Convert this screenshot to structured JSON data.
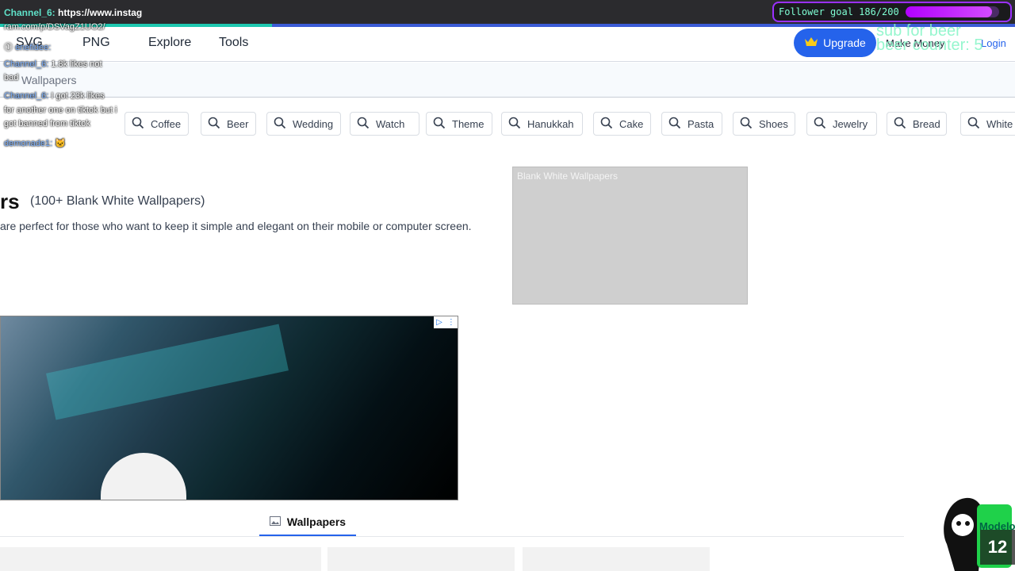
{
  "stream": {
    "chat_header_user": "Channel_6:",
    "chat_header_text": " https://www.instag",
    "follower_goal_label": "Follower goal 186/200",
    "follower_goal_progress": 0.93,
    "bar_progress": 0.268
  },
  "nav": {
    "svg": "SVG",
    "png": "PNG",
    "explore": "Explore",
    "tools": "Tools",
    "upgrade": "Upgrade",
    "make_money": "Make Money",
    "login": "Login"
  },
  "overlay_text": {
    "line1": "sub for beer",
    "line2": "beer counter: 5"
  },
  "search": {
    "placeholder": "Wallpapers"
  },
  "tags": [
    "Coffee",
    "Beer",
    "Wedding",
    "Watch",
    "Theme",
    "Hanukkah",
    "Cake",
    "Pasta",
    "Shoes",
    "Jewelry",
    "Bread",
    "White"
  ],
  "chat": {
    "url_tail": "ram.com/p/DSVagZ1UO2/",
    "m1_user": "enefidee:",
    "m2_user": "Channel_6:",
    "m2_text": " 1.8k likes not",
    "m2_cont": "bad",
    "m3_user": "Channel_6:",
    "m3_text": " I got 23k likes",
    "m3_cont1": "for another one on tiktok but i",
    "m3_cont2": "got banned from tiktok",
    "m4_user": "demonade1:"
  },
  "content": {
    "title_fragment": "rs",
    "subtitle": "(100+ Blank White Wallpapers)",
    "description": "are perfect for those who want to keep it simple and elegant on their mobile or computer screen.",
    "preview_caption": "Blank White Wallpapers"
  },
  "tab": {
    "label": "Wallpapers"
  },
  "counter": {
    "value": "12"
  },
  "colors": {
    "accent": "#2563eb",
    "follower_border": "#9b30ff",
    "overlay_text": "#84f5c6"
  }
}
